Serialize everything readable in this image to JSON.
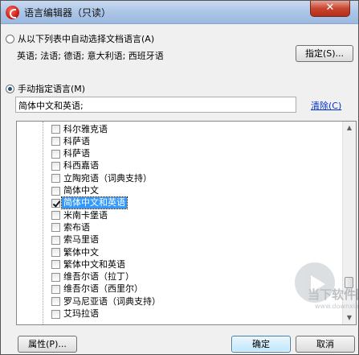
{
  "window": {
    "title": "语言编辑器（只读）",
    "close_label": "✕"
  },
  "auto_option": {
    "label": "从以下列表中自动选择文档语言(A)",
    "languages_text": "英语; 法语; 德语; 意大利语; 西班牙语",
    "specify_button": "指定(S)..."
  },
  "manual_option": {
    "label": "手动指定语言(M)",
    "field_value": "简体中文和英语;",
    "clear_link": "清除(C)"
  },
  "language_list": [
    {
      "label": "科尔雅克语",
      "checked": false,
      "selected": false
    },
    {
      "label": "科萨语",
      "checked": false,
      "selected": false
    },
    {
      "label": "科萨语",
      "checked": false,
      "selected": false
    },
    {
      "label": "科西嘉语",
      "checked": false,
      "selected": false
    },
    {
      "label": "立陶宛语（词典支持）",
      "checked": false,
      "selected": false
    },
    {
      "label": "简体中文",
      "checked": false,
      "selected": false
    },
    {
      "label": "简体中文和英语",
      "checked": true,
      "selected": true
    },
    {
      "label": "米南卡堡语",
      "checked": false,
      "selected": false
    },
    {
      "label": "索布语",
      "checked": false,
      "selected": false
    },
    {
      "label": "索马里语",
      "checked": false,
      "selected": false
    },
    {
      "label": "繁体中文",
      "checked": false,
      "selected": false
    },
    {
      "label": "繁体中文和英语",
      "checked": false,
      "selected": false
    },
    {
      "label": "维吾尔语（拉丁）",
      "checked": false,
      "selected": false
    },
    {
      "label": "维吾尔语（西里尔）",
      "checked": false,
      "selected": false
    },
    {
      "label": "罗马尼亚语（词典支持）",
      "checked": false,
      "selected": false
    },
    {
      "label": "艾玛拉语",
      "checked": false,
      "selected": false
    }
  ],
  "footer": {
    "properties_button": "属性(P)...",
    "ok_button": "确定",
    "cancel_button": "取消"
  },
  "watermark": {
    "text": "当下软件园",
    "url": "www.downxia.com"
  }
}
